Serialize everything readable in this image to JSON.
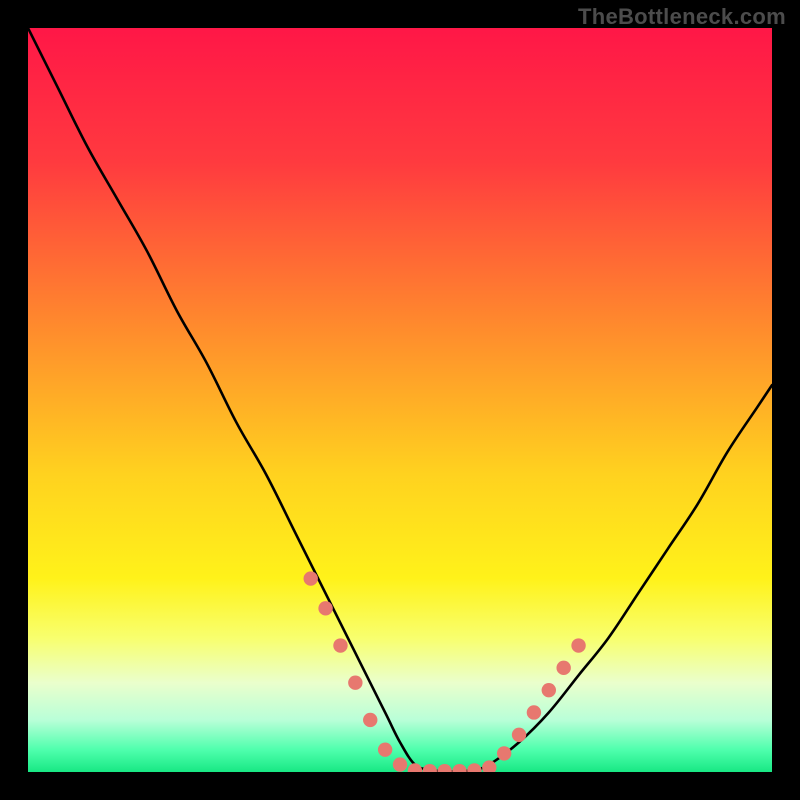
{
  "watermark": "TheBottleneck.com",
  "chart_data": {
    "type": "line",
    "title": "",
    "xlabel": "",
    "ylabel": "",
    "xlim": [
      0,
      100
    ],
    "ylim": [
      0,
      100
    ],
    "gradient_stops": [
      {
        "offset": 0,
        "color": "#ff1747"
      },
      {
        "offset": 18,
        "color": "#ff3a3f"
      },
      {
        "offset": 40,
        "color": "#ff8a2d"
      },
      {
        "offset": 60,
        "color": "#ffd21f"
      },
      {
        "offset": 74,
        "color": "#fff21a"
      },
      {
        "offset": 82,
        "color": "#f8ff6e"
      },
      {
        "offset": 88,
        "color": "#eaffcc"
      },
      {
        "offset": 93,
        "color": "#b9ffd8"
      },
      {
        "offset": 97,
        "color": "#4fffad"
      },
      {
        "offset": 100,
        "color": "#18e884"
      }
    ],
    "series": [
      {
        "name": "curve",
        "x": [
          0,
          4,
          8,
          12,
          16,
          20,
          24,
          28,
          32,
          36,
          40,
          44,
          48,
          50,
          52,
          54,
          56,
          58,
          60,
          62,
          66,
          70,
          74,
          78,
          82,
          86,
          90,
          94,
          98,
          100
        ],
        "y": [
          100,
          92,
          84,
          77,
          70,
          62,
          55,
          47,
          40,
          32,
          24,
          16,
          8,
          4,
          1,
          0.3,
          0.1,
          0.1,
          0.3,
          1,
          4,
          8,
          13,
          18,
          24,
          30,
          36,
          43,
          49,
          52
        ]
      },
      {
        "name": "dots-left",
        "x": [
          38,
          40,
          42,
          44,
          46,
          48,
          50
        ],
        "y": [
          26,
          22,
          17,
          12,
          7,
          3,
          1
        ]
      },
      {
        "name": "dots-bottom",
        "x": [
          52,
          54,
          56,
          58,
          60,
          62
        ],
        "y": [
          0.2,
          0.1,
          0.1,
          0.1,
          0.2,
          0.6
        ]
      },
      {
        "name": "dots-right",
        "x": [
          64,
          66,
          68,
          70,
          72,
          74
        ],
        "y": [
          2.5,
          5,
          8,
          11,
          14,
          17
        ]
      }
    ],
    "dot_color": "#e7786f",
    "line_color": "#000000"
  }
}
